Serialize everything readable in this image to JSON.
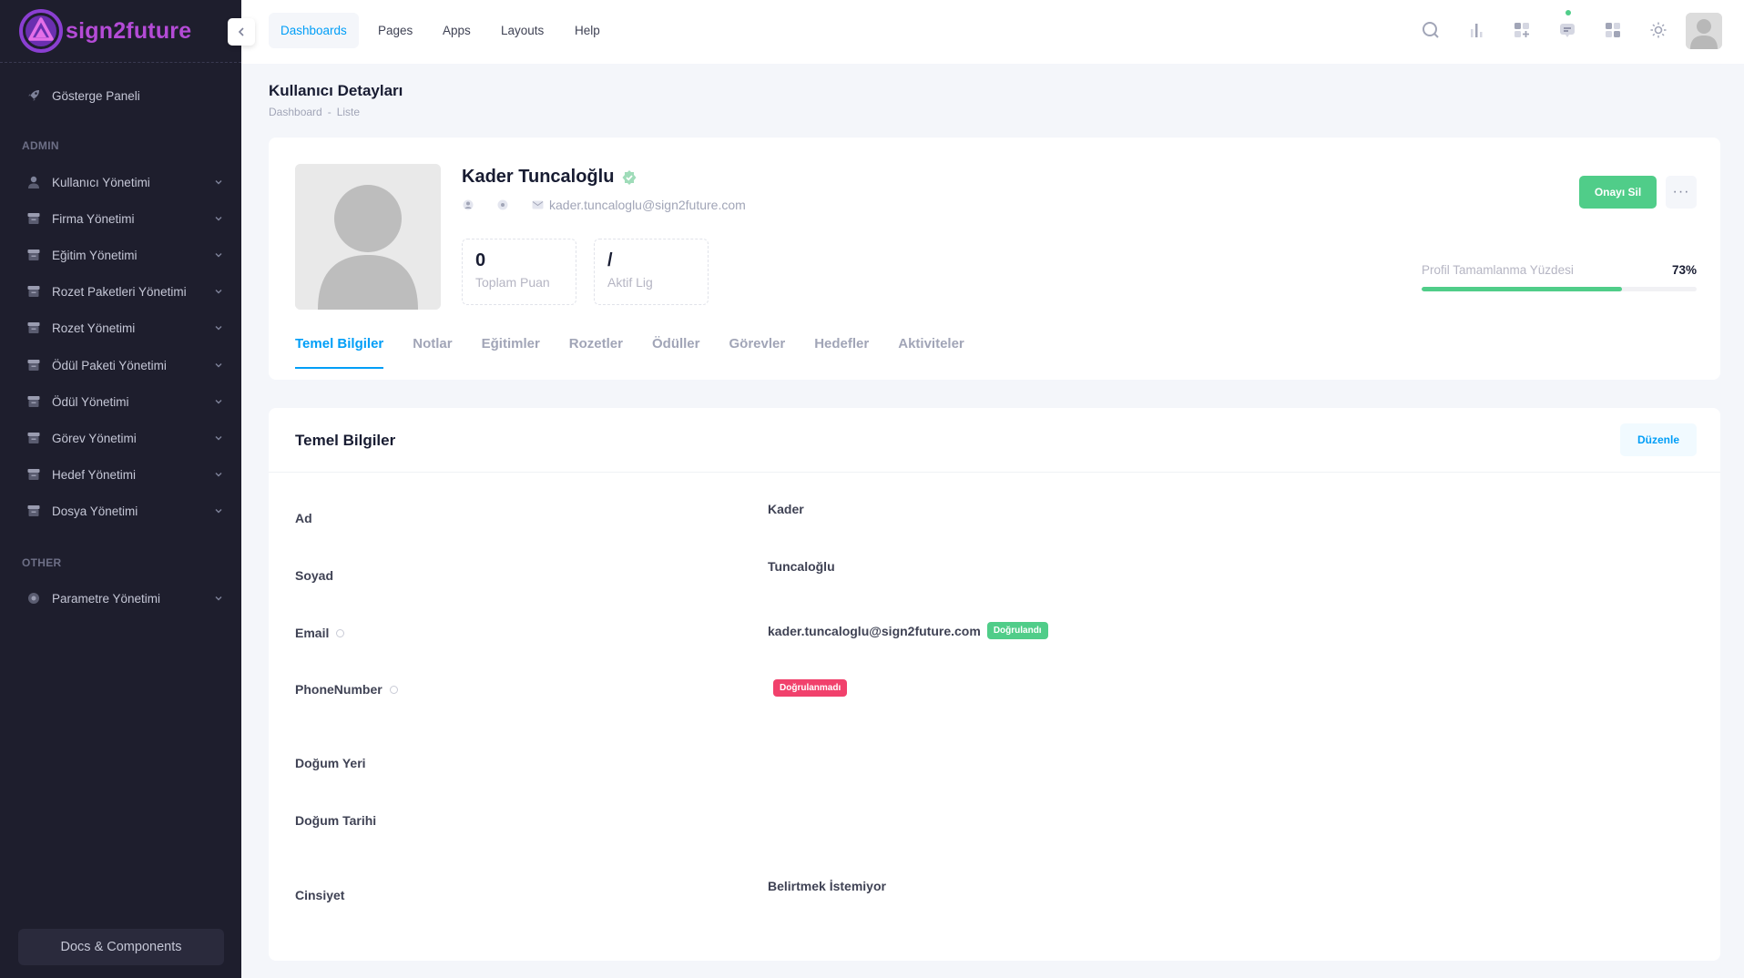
{
  "app": {
    "brand": "sign2future"
  },
  "sidebar": {
    "dashboard_item": "Gösterge Paneli",
    "section_admin": "ADMIN",
    "admin_items": [
      {
        "label": "Kullanıcı Yönetimi",
        "icon": "user-icon"
      },
      {
        "label": "Firma Yönetimi",
        "icon": "folder-icon"
      },
      {
        "label": "Eğitim Yönetimi",
        "icon": "folder-icon"
      },
      {
        "label": "Rozet Paketleri Yönetimi",
        "icon": "folder-icon"
      },
      {
        "label": "Rozet Yönetimi",
        "icon": "folder-icon"
      },
      {
        "label": "Ödül Paketi Yönetimi",
        "icon": "folder-icon"
      },
      {
        "label": "Ödül Yönetimi",
        "icon": "folder-icon"
      },
      {
        "label": "Görev Yönetimi",
        "icon": "folder-icon"
      },
      {
        "label": "Hedef Yönetimi",
        "icon": "folder-icon"
      },
      {
        "label": "Dosya Yönetimi",
        "icon": "folder-icon"
      }
    ],
    "section_other": "OTHER",
    "other_items": [
      {
        "label": "Parametre Yönetimi",
        "icon": "gear-icon"
      }
    ],
    "docs_button": "Docs & Components"
  },
  "header": {
    "nav": [
      "Dashboards",
      "Pages",
      "Apps",
      "Layouts",
      "Help"
    ],
    "active_nav": "Dashboards"
  },
  "page": {
    "title": "Kullanıcı Detayları",
    "breadcrumb": [
      "Dashboard",
      "-",
      "Liste"
    ]
  },
  "profile": {
    "name": "Kader Tuncaloğlu",
    "email": "kader.tuncaloglu@sign2future.com",
    "stats": [
      {
        "value": "0",
        "label": "Toplam Puan"
      },
      {
        "value": "/",
        "label": "Aktif Lig"
      }
    ],
    "remove_approval_button": "Onayı Sil",
    "more_button": "···",
    "progress_label": "Profil Tamamlanma Yüzdesi",
    "progress_text": "73%",
    "progress_value": 0.73,
    "tabs": [
      "Temel Bilgiler",
      "Notlar",
      "Eğitimler",
      "Rozetler",
      "Ödüller",
      "Görevler",
      "Hedefler",
      "Aktiviteler"
    ],
    "active_tab": "Temel Bilgiler"
  },
  "details": {
    "title": "Temel Bilgiler",
    "edit_button": "Düzenle",
    "rows": [
      {
        "label": "Ad",
        "value": "Kader"
      },
      {
        "label": "Soyad",
        "value": "Tuncaloğlu"
      },
      {
        "label": "Email",
        "value": "kader.tuncaloglu@sign2future.com",
        "badge": "Doğrulandı"
      },
      {
        "label": "PhoneNumber",
        "value": "",
        "badge": "Doğrulanmadı"
      },
      {
        "label": "Doğum Yeri",
        "value": ""
      },
      {
        "label": "Doğum Tarihi",
        "value": ""
      },
      {
        "label": "Cinsiyet",
        "value": "Belirtmek İstemiyor"
      }
    ]
  },
  "colors": {
    "sidebar_bg": "#1e1e2d",
    "brand": "#b44bd6",
    "primary": "#009ef7",
    "success": "#50cd89",
    "danger": "#f1416c"
  }
}
